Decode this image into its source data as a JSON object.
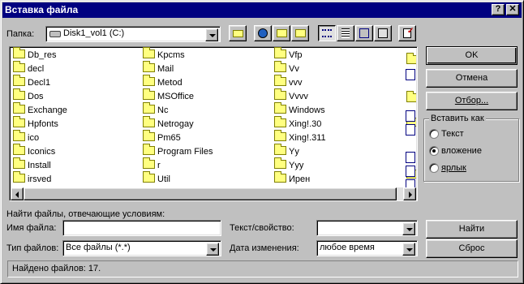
{
  "window": {
    "title": "Вставка файла",
    "help_label": "?",
    "close_label": "✕"
  },
  "folder_bar": {
    "label": "Папка:",
    "current": "Disk1_vol1 (C:)"
  },
  "file_list": {
    "columns": [
      [
        "Db_res",
        "decl",
        "Decl1",
        "Dos",
        "Exchange",
        "Hpfonts",
        "ico",
        "Iconics",
        "Install",
        "irsved"
      ],
      [
        "Kpcms",
        "Mail",
        "Metod",
        "MSOffice",
        "Nc",
        "Netrogay",
        "Pm65",
        "Program Files",
        "r",
        "Util"
      ],
      [
        "Vfp",
        "Vv",
        "vvv",
        "Vvvv",
        "Windows",
        "Xing!.30",
        "Xing!.311",
        "Yy",
        "Yyy",
        "Ирен"
      ]
    ]
  },
  "buttons": {
    "ok": "OK",
    "cancel": "Отмена",
    "select": "Отбор...",
    "find": "Найти",
    "reset": "Сброс"
  },
  "insert_as": {
    "title": "Вставить как",
    "options": [
      "Текст",
      "вложение",
      "ярлык"
    ],
    "selected": "вложение"
  },
  "search": {
    "header": "Найти файлы, отвечающие условиям:",
    "filename_label": "Имя файла:",
    "filename_value": "",
    "filetype_label": "Тип файлов:",
    "filetype_value": "Все файлы (*.*)",
    "text_label": "Текст/свойство:",
    "text_value": "",
    "date_label": "Дата изменения:",
    "date_value": "любое время"
  },
  "status": {
    "text": "Найдено файлов: 17."
  },
  "colors": {
    "titlebar": "#000080",
    "face": "#c0c0c0",
    "folder": "#ffff80"
  }
}
